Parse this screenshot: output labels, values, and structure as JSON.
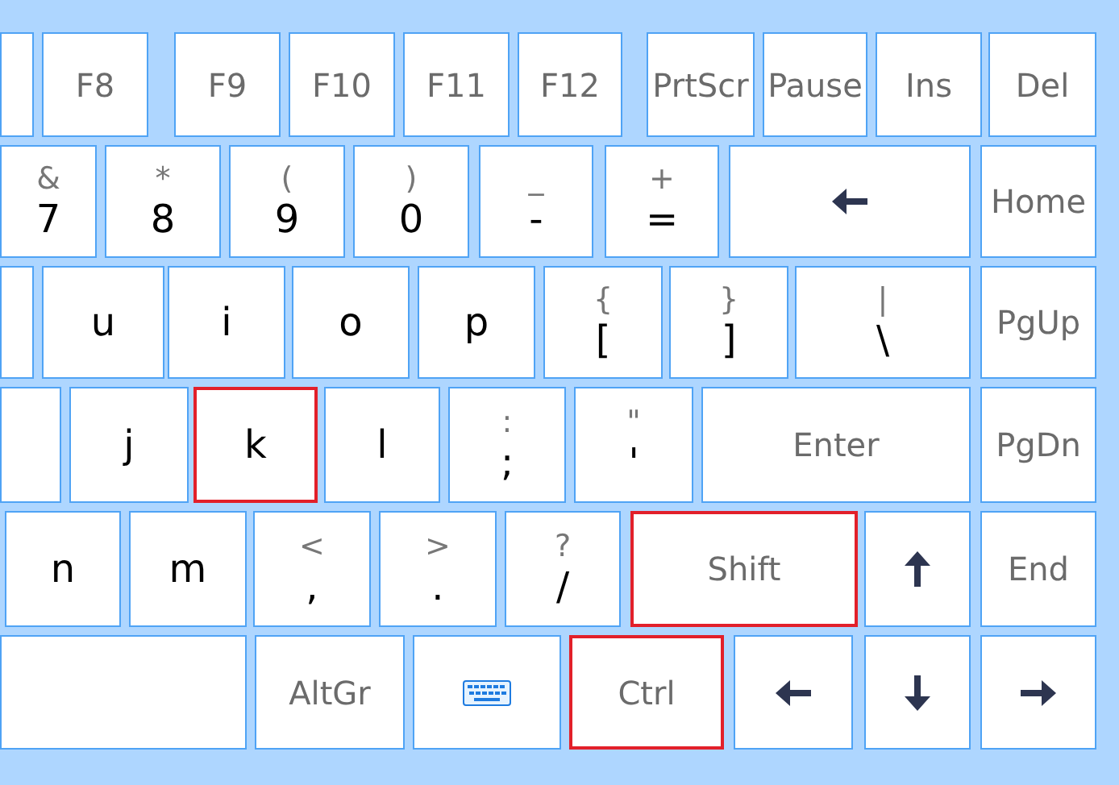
{
  "rows": [
    {
      "keys": [
        {
          "kind": "blank",
          "highlighted": false
        },
        {
          "kind": "named",
          "label": "F8",
          "highlighted": false
        },
        {
          "kind": "named",
          "label": "F9",
          "highlighted": false
        },
        {
          "kind": "named",
          "label": "F10",
          "highlighted": false
        },
        {
          "kind": "named",
          "label": "F11",
          "highlighted": false
        },
        {
          "kind": "named",
          "label": "F12",
          "highlighted": false
        },
        {
          "kind": "named",
          "label": "PrtScr",
          "highlighted": false
        },
        {
          "kind": "named",
          "label": "Pause",
          "highlighted": false
        },
        {
          "kind": "named",
          "label": "Ins",
          "highlighted": false
        },
        {
          "kind": "named",
          "label": "Del",
          "highlighted": false
        }
      ]
    },
    {
      "keys": [
        {
          "kind": "dual",
          "shift": "&",
          "label": "7",
          "highlighted": false
        },
        {
          "kind": "dual",
          "shift": "*",
          "label": "8",
          "highlighted": false
        },
        {
          "kind": "dual",
          "shift": "(",
          "label": "9",
          "highlighted": false
        },
        {
          "kind": "dual",
          "shift": ")",
          "label": "0",
          "highlighted": false
        },
        {
          "kind": "dual",
          "shift": "_",
          "label": "-",
          "highlighted": false
        },
        {
          "kind": "dual",
          "shift": "+",
          "label": "=",
          "highlighted": false
        },
        {
          "kind": "backspace",
          "highlighted": false
        },
        {
          "kind": "named",
          "label": "Home",
          "highlighted": false
        }
      ]
    },
    {
      "keys": [
        {
          "kind": "blank",
          "highlighted": false
        },
        {
          "kind": "char",
          "label": "u",
          "highlighted": false
        },
        {
          "kind": "char",
          "label": "i",
          "highlighted": false
        },
        {
          "kind": "char",
          "label": "o",
          "highlighted": false
        },
        {
          "kind": "char",
          "label": "p",
          "highlighted": false
        },
        {
          "kind": "dual",
          "shift": "{",
          "label": "[",
          "highlighted": false
        },
        {
          "kind": "dual",
          "shift": "}",
          "label": "]",
          "highlighted": false
        },
        {
          "kind": "dual",
          "shift": "|",
          "label": "\\",
          "highlighted": false
        },
        {
          "kind": "named",
          "label": "PgUp",
          "highlighted": false
        }
      ]
    },
    {
      "keys": [
        {
          "kind": "blank",
          "highlighted": false
        },
        {
          "kind": "char",
          "label": "j",
          "highlighted": false
        },
        {
          "kind": "char",
          "label": "k",
          "highlighted": true
        },
        {
          "kind": "char",
          "label": "l",
          "highlighted": false
        },
        {
          "kind": "dual",
          "shift": ":",
          "label": ";",
          "highlighted": false
        },
        {
          "kind": "dual",
          "shift": "\"",
          "label": "'",
          "highlighted": false
        },
        {
          "kind": "named",
          "label": "Enter",
          "highlighted": false
        },
        {
          "kind": "named",
          "label": "PgDn",
          "highlighted": false
        }
      ]
    },
    {
      "keys": [
        {
          "kind": "char",
          "label": "n",
          "highlighted": false
        },
        {
          "kind": "char",
          "label": "m",
          "highlighted": false
        },
        {
          "kind": "dual",
          "shift": "<",
          "label": ",",
          "highlighted": false
        },
        {
          "kind": "dual",
          "shift": ">",
          "label": ".",
          "highlighted": false
        },
        {
          "kind": "dual",
          "shift": "?",
          "label": "/",
          "highlighted": false
        },
        {
          "kind": "named",
          "label": "Shift",
          "highlighted": true
        },
        {
          "kind": "arrow-up",
          "highlighted": false
        },
        {
          "kind": "named",
          "label": "End",
          "highlighted": false
        }
      ]
    },
    {
      "keys": [
        {
          "kind": "blank",
          "highlighted": false
        },
        {
          "kind": "named",
          "label": "AltGr",
          "highlighted": false
        },
        {
          "kind": "keyboard",
          "highlighted": false
        },
        {
          "kind": "named",
          "label": "Ctrl",
          "highlighted": true
        },
        {
          "kind": "arrow-left",
          "highlighted": false
        },
        {
          "kind": "arrow-down",
          "highlighted": false
        },
        {
          "kind": "arrow-right",
          "highlighted": false
        }
      ]
    }
  ]
}
